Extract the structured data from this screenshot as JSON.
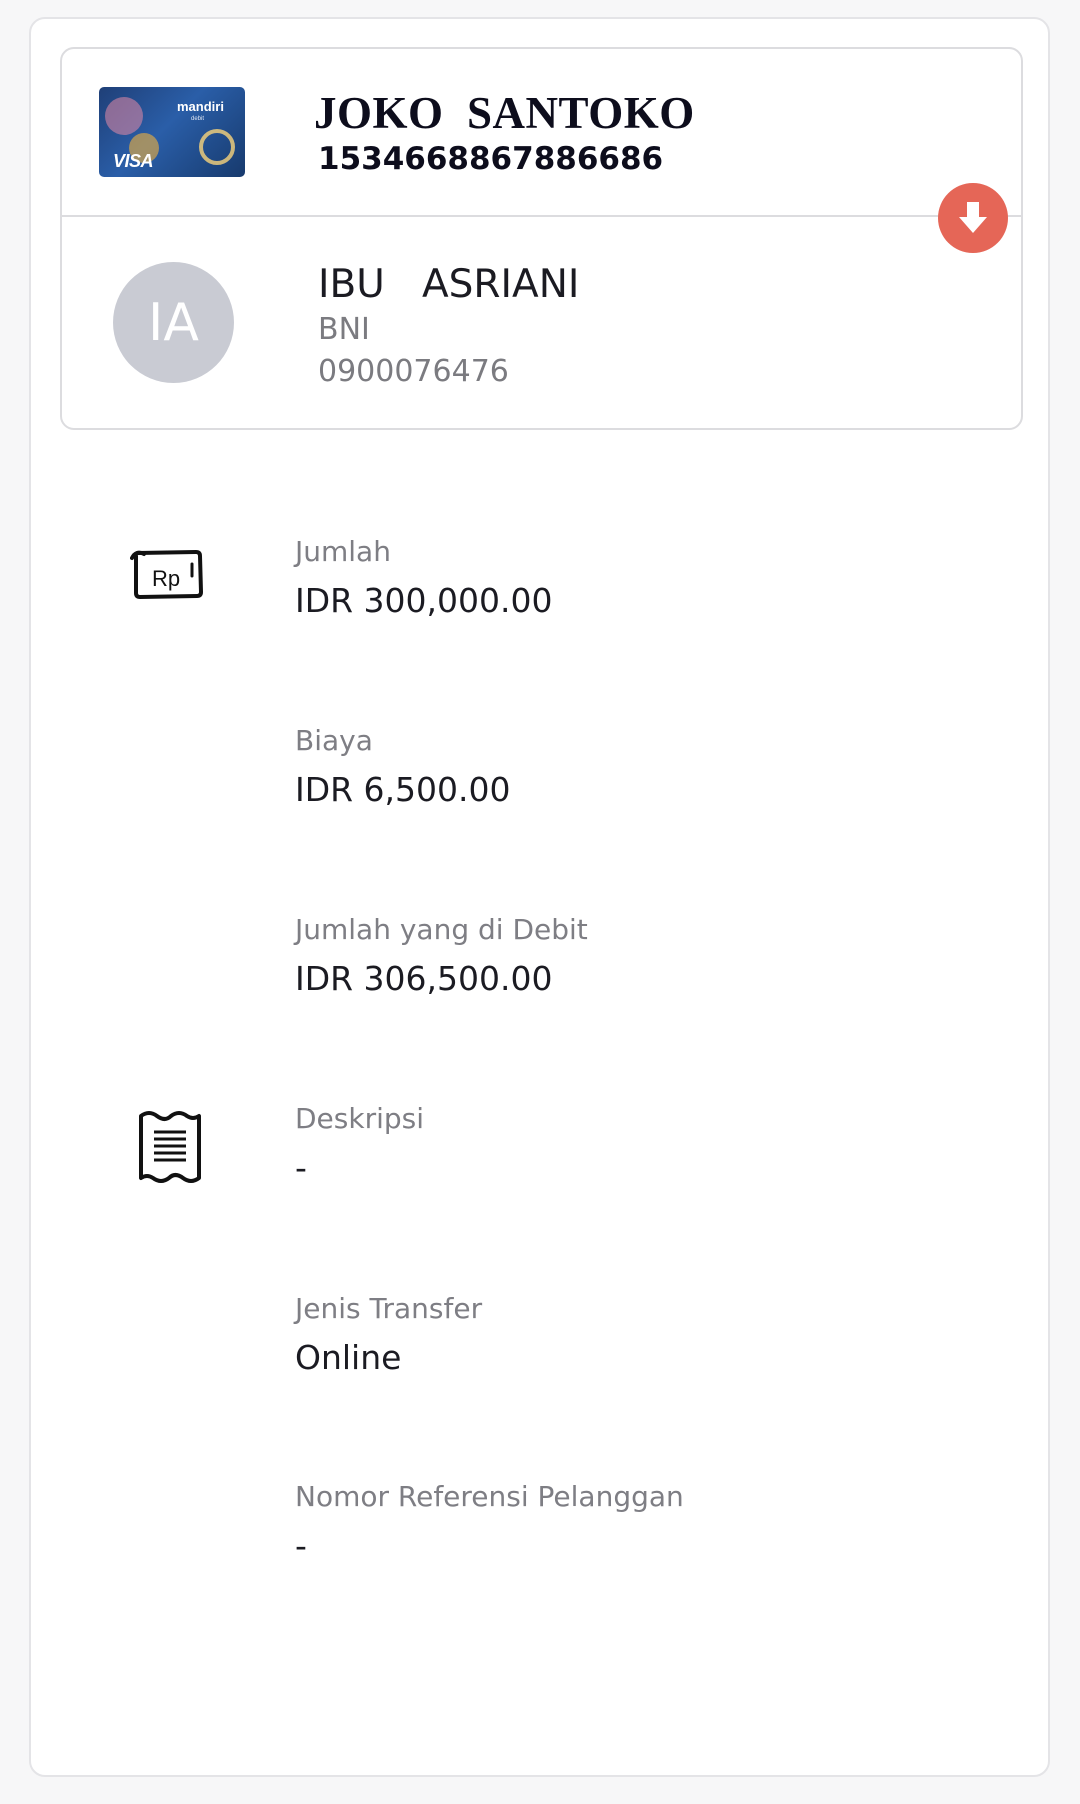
{
  "sender": {
    "card_brand": "mandiri",
    "card_brand_sub": "debit",
    "card_network": "VISA",
    "name": "JOKO  SANTOKO",
    "account_number": "1534668867886686"
  },
  "recipient": {
    "initials": "IA",
    "name": "IBU   ASRIANI",
    "bank": "BNI",
    "account_number": "0900076476"
  },
  "details": {
    "amount": {
      "label": "Jumlah",
      "value": "IDR 300,000.00"
    },
    "fee": {
      "label": "Biaya",
      "value": "IDR 6,500.00"
    },
    "debited": {
      "label": "Jumlah yang di Debit",
      "value": "IDR 306,500.00"
    },
    "description": {
      "label": "Deskripsi",
      "value": "-"
    },
    "transfer_type": {
      "label": "Jenis Transfer",
      "value": "Online"
    },
    "reference": {
      "label": "Nomor Referensi Pelanggan",
      "value": "-"
    }
  },
  "icons": {
    "direction": "arrow-down-icon",
    "amount": "rupiah-money-icon",
    "description": "receipt-icon"
  },
  "colors": {
    "direction_button": "#e56657",
    "avatar": "#c9cbd3",
    "card_border": "#dcdcdf"
  }
}
